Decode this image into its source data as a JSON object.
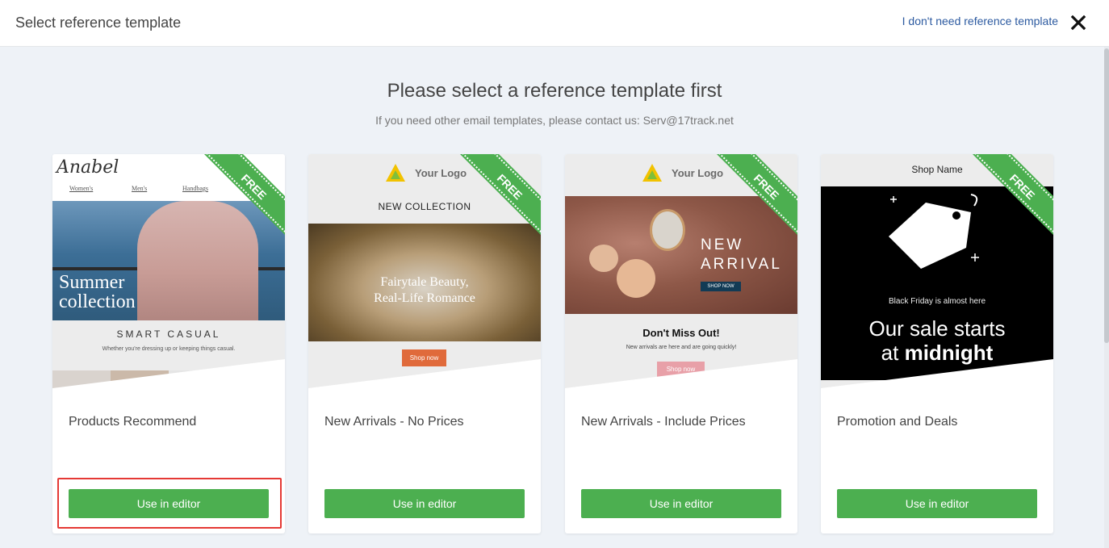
{
  "header": {
    "title": "Select reference template",
    "skip_link": "I don't need reference template",
    "close_icon": "close-icon"
  },
  "main": {
    "heading": "Please select a reference template first",
    "subheading": "If you need other email templates, please contact us: Serv@17track.net"
  },
  "badge_label": "FREE",
  "accent_color": "#4caf50",
  "highlight_color": "#e53935",
  "cards": [
    {
      "name": "Products Recommend",
      "button": "Use in editor",
      "preview": {
        "logo": "Anabel",
        "nav": [
          "Women's",
          "Men's",
          "Handbags"
        ],
        "caption_line1": "Summer",
        "caption_line2": "collection",
        "tagline": "SMART CASUAL",
        "description": "Whether you're dressing up or keeping things casual."
      }
    },
    {
      "name": "New Arrivals - No Prices",
      "button": "Use in editor",
      "preview": {
        "logo_text": "Your Logo",
        "banner": "NEW COLLECTION",
        "caption_line1": "Fairytale Beauty,",
        "caption_line2": "Real-Life Romance",
        "cta": "Shop now"
      }
    },
    {
      "name": "New Arrivals - Include Prices",
      "button": "Use in editor",
      "preview": {
        "logo_text": "Your Logo",
        "headline_line1": "NEW",
        "headline_line2": "ARRIVAL",
        "hero_cta": "SHOP NOW",
        "title": "Don't Miss Out!",
        "subtitle": "New arrivals are here and are going quickly!",
        "cta": "Shop now"
      }
    },
    {
      "name": "Promotion and Deals",
      "button": "Use in editor",
      "preview": {
        "shop_name": "Shop Name",
        "eyebrow": "Black Friday is almost here",
        "headline_line1": "Our sale starts",
        "headline_line2_prefix": "at ",
        "headline_line2_bold": "midnight"
      }
    }
  ]
}
